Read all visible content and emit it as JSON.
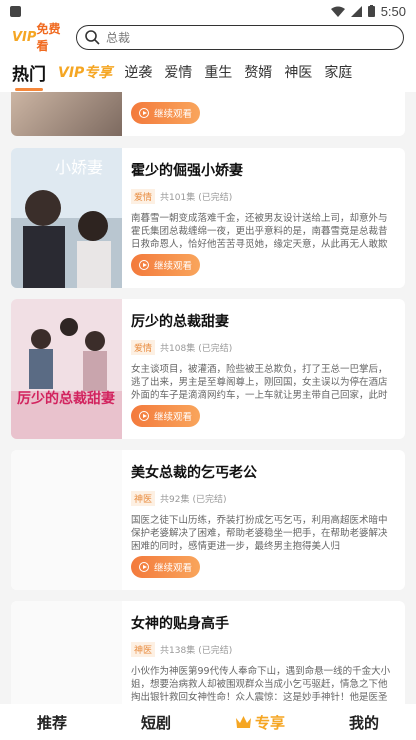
{
  "status": {
    "time": "5:50"
  },
  "header": {
    "logo_vip": "VIP",
    "logo_text": "免费看",
    "search_placeholder": "总裁"
  },
  "tabs": [
    {
      "label": "热门"
    },
    {
      "label": "VIP专享"
    },
    {
      "label": "逆袭"
    },
    {
      "label": "爱情"
    },
    {
      "label": "重生"
    },
    {
      "label": "赘婿"
    },
    {
      "label": "神医"
    },
    {
      "label": "家庭"
    }
  ],
  "cards": [
    {
      "title": "",
      "button": "继续观看"
    },
    {
      "title": "霍少的倔强小娇妻",
      "tag": "爱情",
      "episodes": "共101集",
      "status": "(已完结)",
      "desc": "南暮雪一朝变成落难千金，还被男友设计送给上司，却意外与霍氏集团总裁缠绵一夜，更出乎意料的是，南暮雪竟是总裁昔日救命恩人，恰好他苦苦寻觅她，缘定天意，从此再无人敢欺辱霍氏...",
      "button": "继续观看",
      "cover_text": "小娇妻"
    },
    {
      "title": "厉少的总裁甜妻",
      "tag": "爱情",
      "episodes": "共108集",
      "status": "(已完结)",
      "desc": "女主谈项目，被灌酒，险些被王总欺负，打了王总一巴掌后，逃了出来，男主是至尊阁尊上，刚回国，女主误以为停在酒店外面的车子是滴滴网约车，一上车就让男主带自己回家，此时女主已经...",
      "button": "继续观看",
      "cover_text": "厉少的总裁甜妻"
    },
    {
      "title": "美女总裁的乞丐老公",
      "tag": "神医",
      "episodes": "共92集",
      "status": "(已完结)",
      "desc": "国医之徒下山历练，乔装打扮成乞丐乞丐，利用高超医术暗中保护老婆解决了困难，帮助老婆稳坐一把手，在帮助老婆解决困难的同时，感情更进一步，最终男主抱得美人归",
      "button": "继续观看"
    },
    {
      "title": "女神的贴身高手",
      "tag": "神医",
      "episodes": "共138集",
      "status": "(已完结)",
      "desc": "小伙作为神医第99代传人奉命下山，遇到命悬一线的千金大小姐，想要治病救人却被围观群众当成小乞丐驱赶，情急之下他掏出银针救回女神性命！众人震惊：这是妙手神针！他是医圣传人..."
    }
  ],
  "bottom_nav": [
    {
      "label": "推荐"
    },
    {
      "label": "短剧"
    },
    {
      "label": "专享"
    },
    {
      "label": "我的"
    }
  ],
  "colors": {
    "accent": "#f5873a",
    "vip": "#f5a623",
    "tag_bg": "#fdf0e3"
  }
}
